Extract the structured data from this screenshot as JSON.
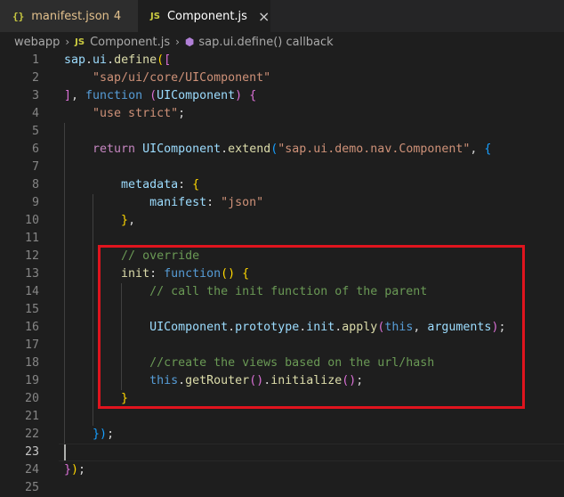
{
  "tabs": [
    {
      "icon": "{}",
      "label": "manifest.json",
      "badge": "4",
      "close": ""
    },
    {
      "icon": "JS",
      "label": "Component.js",
      "badge": "",
      "close": "×"
    }
  ],
  "breadcrumb": {
    "folder": "webapp",
    "file_icon": "JS",
    "file": "Component.js",
    "symbol": "sap.ui.define() callback"
  },
  "editor": {
    "active_line": 23,
    "line_numbers": [
      "1",
      "2",
      "3",
      "4",
      "5",
      "6",
      "7",
      "8",
      "9",
      "10",
      "11",
      "12",
      "13",
      "14",
      "15",
      "16",
      "17",
      "18",
      "19",
      "20",
      "21",
      "22",
      "23",
      "24",
      "25"
    ],
    "lines": [
      [
        [
          "var",
          "sap"
        ],
        [
          "pun",
          "."
        ],
        [
          "var",
          "ui"
        ],
        [
          "pun",
          "."
        ],
        [
          "fn",
          "define"
        ],
        [
          "brk1",
          "("
        ],
        [
          "brk2",
          "["
        ]
      ],
      [
        [
          "pun",
          "    "
        ],
        [
          "str",
          "\"sap/ui/core/UIComponent\""
        ]
      ],
      [
        [
          "brk2",
          "]"
        ],
        [
          "pun",
          ", "
        ],
        [
          "kw",
          "function"
        ],
        [
          "pun",
          " "
        ],
        [
          "brk2",
          "("
        ],
        [
          "var",
          "UIComponent"
        ],
        [
          "brk2",
          ")"
        ],
        [
          "pun",
          " "
        ],
        [
          "brk2",
          "{"
        ]
      ],
      [
        [
          "pun",
          "    "
        ],
        [
          "str",
          "\"use strict\""
        ],
        [
          "pun",
          ";"
        ]
      ],
      [],
      [
        [
          "pun",
          "    "
        ],
        [
          "ctl",
          "return"
        ],
        [
          "pun",
          " "
        ],
        [
          "var",
          "UIComponent"
        ],
        [
          "pun",
          "."
        ],
        [
          "fn",
          "extend"
        ],
        [
          "brk3",
          "("
        ],
        [
          "str",
          "\"sap.ui.demo.nav.Component\""
        ],
        [
          "pun",
          ", "
        ],
        [
          "brk3",
          "{"
        ]
      ],
      [],
      [
        [
          "pun",
          "        "
        ],
        [
          "var",
          "metadata"
        ],
        [
          "pun",
          ": "
        ],
        [
          "brk1",
          "{"
        ]
      ],
      [
        [
          "pun",
          "            "
        ],
        [
          "var",
          "manifest"
        ],
        [
          "pun",
          ": "
        ],
        [
          "str",
          "\"json\""
        ]
      ],
      [
        [
          "pun",
          "        "
        ],
        [
          "brk1",
          "}"
        ],
        [
          "pun",
          ","
        ]
      ],
      [],
      [
        [
          "pun",
          "        "
        ],
        [
          "cmt",
          "// override"
        ]
      ],
      [
        [
          "pun",
          "        "
        ],
        [
          "fn",
          "init"
        ],
        [
          "pun",
          ": "
        ],
        [
          "kw",
          "function"
        ],
        [
          "brk1",
          "()"
        ],
        [
          "pun",
          " "
        ],
        [
          "brk1",
          "{"
        ]
      ],
      [
        [
          "pun",
          "            "
        ],
        [
          "cmt",
          "// call the init function of the parent"
        ]
      ],
      [],
      [
        [
          "pun",
          "            "
        ],
        [
          "var",
          "UIComponent"
        ],
        [
          "pun",
          "."
        ],
        [
          "var",
          "prototype"
        ],
        [
          "pun",
          "."
        ],
        [
          "var",
          "init"
        ],
        [
          "pun",
          "."
        ],
        [
          "fn",
          "apply"
        ],
        [
          "brk2",
          "("
        ],
        [
          "kw",
          "this"
        ],
        [
          "pun",
          ", "
        ],
        [
          "var",
          "arguments"
        ],
        [
          "brk2",
          ")"
        ],
        [
          "pun",
          ";"
        ]
      ],
      [],
      [
        [
          "pun",
          "            "
        ],
        [
          "cmt",
          "//create the views based on the url/hash"
        ]
      ],
      [
        [
          "pun",
          "            "
        ],
        [
          "kw",
          "this"
        ],
        [
          "pun",
          "."
        ],
        [
          "fn",
          "getRouter"
        ],
        [
          "brk2",
          "()"
        ],
        [
          "pun",
          "."
        ],
        [
          "fn",
          "initialize"
        ],
        [
          "brk2",
          "()"
        ],
        [
          "pun",
          ";"
        ]
      ],
      [
        [
          "pun",
          "        "
        ],
        [
          "brk1",
          "}"
        ]
      ],
      [],
      [
        [
          "pun",
          "    "
        ],
        [
          "brk3",
          "}"
        ],
        [
          "brk3",
          ")"
        ],
        [
          "pun",
          ";"
        ]
      ],
      [],
      [
        [
          "brk2",
          "}"
        ],
        [
          "brk1",
          ")"
        ],
        [
          "pun",
          ";"
        ]
      ],
      []
    ]
  }
}
